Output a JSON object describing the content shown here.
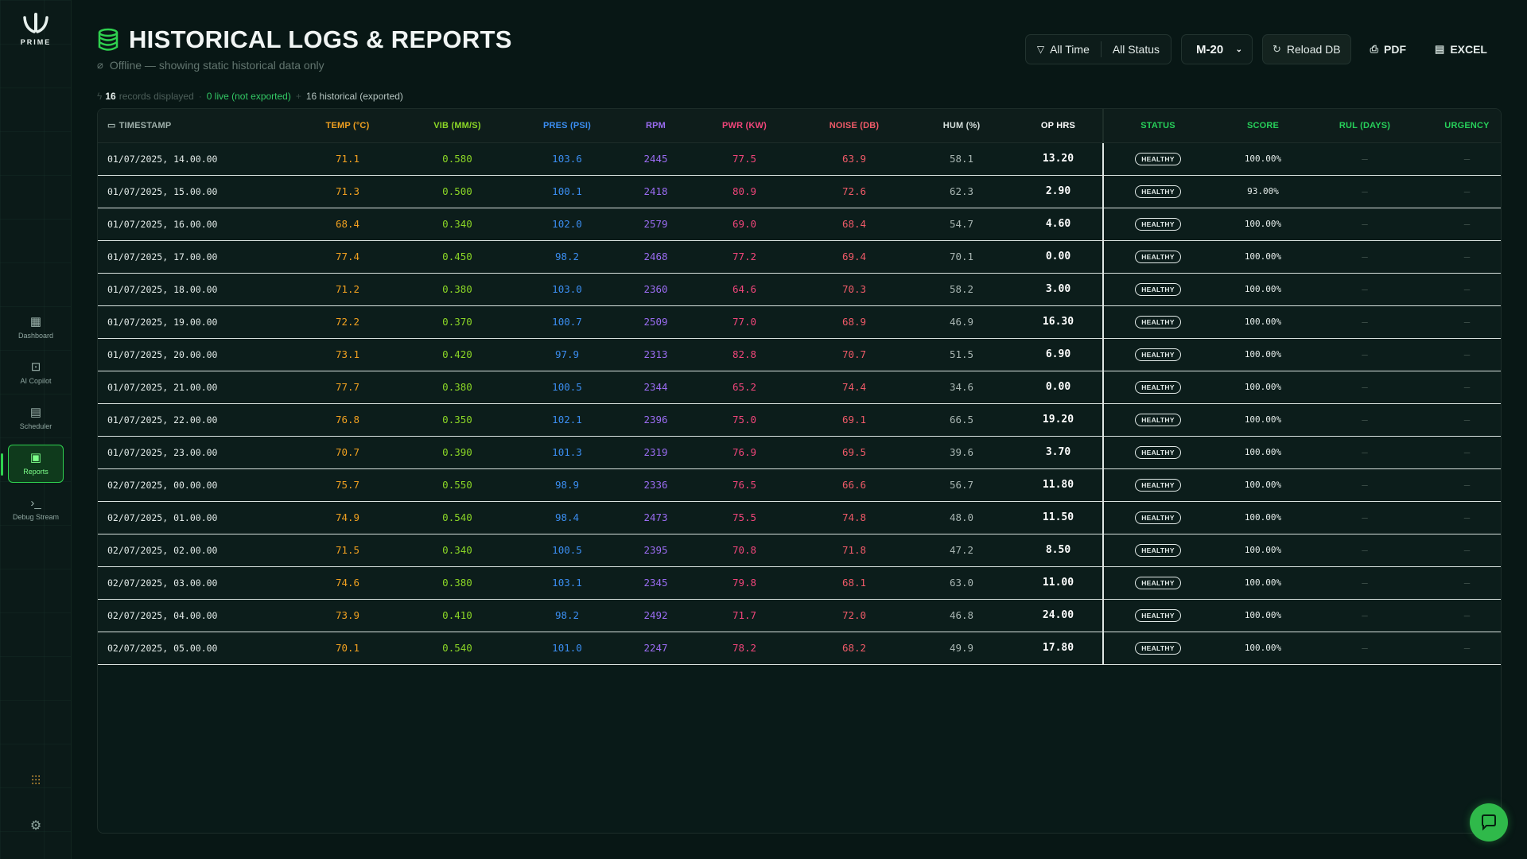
{
  "brand": {
    "name": "PRIME"
  },
  "sidebar": {
    "items": [
      {
        "label": "Dashboard",
        "icon": "grid-icon",
        "active": false
      },
      {
        "label": "AI Copilot",
        "icon": "robot-icon",
        "active": false
      },
      {
        "label": "Scheduler",
        "icon": "calendar-icon",
        "active": false
      },
      {
        "label": "Reports",
        "icon": "clipboard-icon",
        "active": true
      },
      {
        "label": "Debug Stream",
        "icon": "terminal-icon",
        "active": false
      }
    ],
    "bottom": [
      {
        "icon": "sliders-icon"
      },
      {
        "icon": "gear-icon"
      }
    ]
  },
  "header": {
    "title": "HISTORICAL LOGS & REPORTS",
    "subtitle": "Offline — showing static historical data only"
  },
  "stats": {
    "count": "16",
    "count_label": "records displayed",
    "live": "0 live (not exported)",
    "historical": "16 historical (exported)"
  },
  "toolbar": {
    "time_filter": "All Time",
    "status_filter": "All Status",
    "machine": "M-20",
    "reload": "Reload DB",
    "pdf": "PDF",
    "excel": "EXCEL"
  },
  "table": {
    "headers": {
      "timestamp": "TIMESTAMP",
      "temp": "TEMP (°C)",
      "vib": "VIB (MM/S)",
      "pres": "PRES (PSI)",
      "rpm": "RPM",
      "pwr": "PWR (KW)",
      "noise": "NOISE (DB)",
      "hum": "HUM (%)",
      "op": "OP HRS",
      "status": "STATUS",
      "score": "SCORE",
      "rul": "RUL (DAYS)",
      "urgency": "URGENCY"
    },
    "rows": [
      {
        "ts": "01/07/2025, 14.00.00",
        "temp": "71.1",
        "vib": "0.580",
        "pres": "103.6",
        "rpm": "2445",
        "pwr": "77.5",
        "noise": "63.9",
        "hum": "58.1",
        "op": "13.20",
        "status": "HEALTHY",
        "score": "100.00%",
        "rul": "–",
        "urgency": "–"
      },
      {
        "ts": "01/07/2025, 15.00.00",
        "temp": "71.3",
        "vib": "0.500",
        "pres": "100.1",
        "rpm": "2418",
        "pwr": "80.9",
        "noise": "72.6",
        "hum": "62.3",
        "op": "2.90",
        "status": "HEALTHY",
        "score": "93.00%",
        "rul": "–",
        "urgency": "–"
      },
      {
        "ts": "01/07/2025, 16.00.00",
        "temp": "68.4",
        "vib": "0.340",
        "pres": "102.0",
        "rpm": "2579",
        "pwr": "69.0",
        "noise": "68.4",
        "hum": "54.7",
        "op": "4.60",
        "status": "HEALTHY",
        "score": "100.00%",
        "rul": "–",
        "urgency": "–"
      },
      {
        "ts": "01/07/2025, 17.00.00",
        "temp": "77.4",
        "vib": "0.450",
        "pres": "98.2",
        "rpm": "2468",
        "pwr": "77.2",
        "noise": "69.4",
        "hum": "70.1",
        "op": "0.00",
        "status": "HEALTHY",
        "score": "100.00%",
        "rul": "–",
        "urgency": "–"
      },
      {
        "ts": "01/07/2025, 18.00.00",
        "temp": "71.2",
        "vib": "0.380",
        "pres": "103.0",
        "rpm": "2360",
        "pwr": "64.6",
        "noise": "70.3",
        "hum": "58.2",
        "op": "3.00",
        "status": "HEALTHY",
        "score": "100.00%",
        "rul": "–",
        "urgency": "–"
      },
      {
        "ts": "01/07/2025, 19.00.00",
        "temp": "72.2",
        "vib": "0.370",
        "pres": "100.7",
        "rpm": "2509",
        "pwr": "77.0",
        "noise": "68.9",
        "hum": "46.9",
        "op": "16.30",
        "status": "HEALTHY",
        "score": "100.00%",
        "rul": "–",
        "urgency": "–"
      },
      {
        "ts": "01/07/2025, 20.00.00",
        "temp": "73.1",
        "vib": "0.420",
        "pres": "97.9",
        "rpm": "2313",
        "pwr": "82.8",
        "noise": "70.7",
        "hum": "51.5",
        "op": "6.90",
        "status": "HEALTHY",
        "score": "100.00%",
        "rul": "–",
        "urgency": "–"
      },
      {
        "ts": "01/07/2025, 21.00.00",
        "temp": "77.7",
        "vib": "0.380",
        "pres": "100.5",
        "rpm": "2344",
        "pwr": "65.2",
        "noise": "74.4",
        "hum": "34.6",
        "op": "0.00",
        "status": "HEALTHY",
        "score": "100.00%",
        "rul": "–",
        "urgency": "–"
      },
      {
        "ts": "01/07/2025, 22.00.00",
        "temp": "76.8",
        "vib": "0.350",
        "pres": "102.1",
        "rpm": "2396",
        "pwr": "75.0",
        "noise": "69.1",
        "hum": "66.5",
        "op": "19.20",
        "status": "HEALTHY",
        "score": "100.00%",
        "rul": "–",
        "urgency": "–"
      },
      {
        "ts": "01/07/2025, 23.00.00",
        "temp": "70.7",
        "vib": "0.390",
        "pres": "101.3",
        "rpm": "2319",
        "pwr": "76.9",
        "noise": "69.5",
        "hum": "39.6",
        "op": "3.70",
        "status": "HEALTHY",
        "score": "100.00%",
        "rul": "–",
        "urgency": "–"
      },
      {
        "ts": "02/07/2025, 00.00.00",
        "temp": "75.7",
        "vib": "0.550",
        "pres": "98.9",
        "rpm": "2336",
        "pwr": "76.5",
        "noise": "66.6",
        "hum": "56.7",
        "op": "11.80",
        "status": "HEALTHY",
        "score": "100.00%",
        "rul": "–",
        "urgency": "–"
      },
      {
        "ts": "02/07/2025, 01.00.00",
        "temp": "74.9",
        "vib": "0.540",
        "pres": "98.4",
        "rpm": "2473",
        "pwr": "75.5",
        "noise": "74.8",
        "hum": "48.0",
        "op": "11.50",
        "status": "HEALTHY",
        "score": "100.00%",
        "rul": "–",
        "urgency": "–"
      },
      {
        "ts": "02/07/2025, 02.00.00",
        "temp": "71.5",
        "vib": "0.340",
        "pres": "100.5",
        "rpm": "2395",
        "pwr": "70.8",
        "noise": "71.8",
        "hum": "47.2",
        "op": "8.50",
        "status": "HEALTHY",
        "score": "100.00%",
        "rul": "–",
        "urgency": "–"
      },
      {
        "ts": "02/07/2025, 03.00.00",
        "temp": "74.6",
        "vib": "0.380",
        "pres": "103.1",
        "rpm": "2345",
        "pwr": "79.8",
        "noise": "68.1",
        "hum": "63.0",
        "op": "11.00",
        "status": "HEALTHY",
        "score": "100.00%",
        "rul": "–",
        "urgency": "–"
      },
      {
        "ts": "02/07/2025, 04.00.00",
        "temp": "73.9",
        "vib": "0.410",
        "pres": "98.2",
        "rpm": "2492",
        "pwr": "71.7",
        "noise": "72.0",
        "hum": "46.8",
        "op": "24.00",
        "status": "HEALTHY",
        "score": "100.00%",
        "rul": "–",
        "urgency": "–"
      },
      {
        "ts": "02/07/2025, 05.00.00",
        "temp": "70.1",
        "vib": "0.540",
        "pres": "101.0",
        "rpm": "2247",
        "pwr": "78.2",
        "noise": "68.2",
        "hum": "49.9",
        "op": "17.80",
        "status": "HEALTHY",
        "score": "100.00%",
        "rul": "–",
        "urgency": "–"
      }
    ]
  },
  "colors": {
    "accent": "#2fd14f",
    "temp": "#f0a020",
    "vib": "#8bd626",
    "pres": "#3b8df0",
    "rpm": "#9b6cf2",
    "pwr": "#f0457a",
    "noise": "#f05a68"
  }
}
